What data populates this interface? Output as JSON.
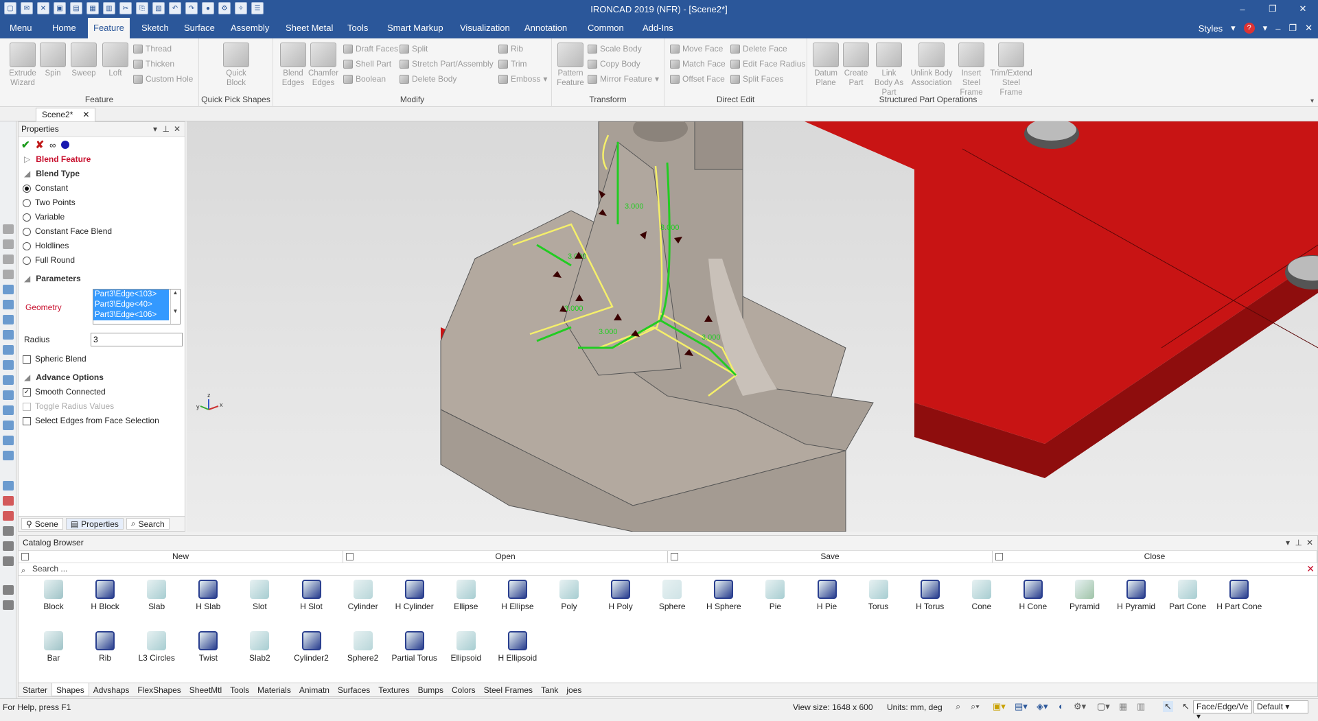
{
  "window": {
    "title": "IRONCAD 2019 (NFR) - [Scene2*]",
    "controls": [
      "–",
      "❐",
      "✕"
    ]
  },
  "menu_tabs": [
    "Menu",
    "Home",
    "Feature",
    "Sketch",
    "Surface",
    "Assembly",
    "Sheet Metal",
    "Tools",
    "Smart Markup",
    "Visualization",
    "Annotation",
    "Common",
    "Add-Ins"
  ],
  "menu_right": {
    "styles": "Styles",
    "help": "?"
  },
  "ribbon": {
    "feature": {
      "label": "Feature",
      "big": [
        "Extrude Wizard",
        "Spin",
        "Sweep",
        "Loft"
      ],
      "small": [
        "Thread",
        "Thicken",
        "Custom Hole"
      ]
    },
    "quick_pick": {
      "label": "Quick Pick Shapes",
      "big": [
        "Quick Block"
      ]
    },
    "modify": {
      "label": "Modify",
      "big": [
        "Blend Edges",
        "Chamfer Edges"
      ],
      "small": [
        "Draft Faces",
        "Shell Part",
        "Boolean",
        "Split",
        "Stretch Part/Assembly",
        "Delete Body",
        "Rib",
        "Trim",
        "Emboss"
      ]
    },
    "transform": {
      "label": "Transform",
      "big": [
        "Pattern Feature"
      ],
      "small": [
        "Scale Body",
        "Copy Body",
        "Mirror Feature"
      ]
    },
    "direct_edit": {
      "label": "Direct Edit",
      "small": [
        "Move Face",
        "Match Face",
        "Offset Face",
        "Delete Face",
        "Edit Face Radius",
        "Split Faces"
      ]
    },
    "structured": {
      "label": "Structured Part Operations",
      "big": [
        "Datum Plane",
        "Create Part",
        "Link Body As Part",
        "Unlink Body Association",
        "Insert Steel Frame",
        "Trim/Extend Steel Frame"
      ]
    }
  },
  "doc_tab": {
    "name": "Scene2*",
    "close": "✕"
  },
  "properties": {
    "title": "Properties",
    "blend_feature": "Blend Feature",
    "blend_type_label": "Blend Type",
    "blend_types": [
      "Constant",
      "Two Points",
      "Variable",
      "Constant Face Blend",
      "Holdlines",
      "Full Round"
    ],
    "selected_type": "Constant",
    "parameters_label": "Parameters",
    "geometry_label": "Geometry",
    "geometry_items": [
      "Part3\\Edge<103>",
      "Part3\\Edge<40>",
      "Part3\\Edge<106>"
    ],
    "radius_label": "Radius",
    "radius_value": "3",
    "spheric_blend": "Spheric Blend",
    "advance_label": "Advance Options",
    "smooth_connected": "Smooth Connected",
    "toggle_radius": "Toggle Radius Values",
    "select_edges": "Select Edges from Face Selection",
    "tabs": [
      "Scene",
      "Properties",
      "Search"
    ]
  },
  "viewport": {
    "dim_labels": [
      "3.000",
      "3.000",
      "3.000",
      "3.000",
      "3.000",
      "3.000"
    ],
    "axes": [
      "z",
      "y",
      "x"
    ]
  },
  "catalog": {
    "title": "Catalog Browser",
    "actions": [
      "New",
      "Open",
      "Save",
      "Close"
    ],
    "search_placeholder": "Search ...",
    "shapes_row1": [
      "Block",
      "H Block",
      "Slab",
      "H Slab",
      "Slot",
      "H Slot",
      "Cylinder",
      "H Cylinder",
      "Ellipse",
      "H Ellipse",
      "Poly",
      "H Poly",
      "Sphere",
      "H Sphere",
      "Pie",
      "H Pie",
      "Torus",
      "H Torus",
      "Cone",
      "H Cone",
      "Pyramid",
      "H Pyramid",
      "Part Cone",
      "H Part Cone"
    ],
    "shapes_row2": [
      "Bar",
      "Rib",
      "L3 Circles",
      "Twist",
      "Slab2",
      "Cylinder2",
      "Sphere2",
      "Partial Torus",
      "Ellipsoid",
      "H Ellipsoid"
    ],
    "tabs": [
      "Starter",
      "Shapes",
      "Advshaps",
      "FlexShapes",
      "SheetMtl",
      "Tools",
      "Materials",
      "Animatn",
      "Surfaces",
      "Textures",
      "Bumps",
      "Colors",
      "Steel Frames",
      "Tank",
      "joes"
    ],
    "active_tab": "Shapes"
  },
  "status": {
    "help": "For Help, press F1",
    "view_size": "View size: 1648 x  600",
    "units": "Units: mm, deg",
    "filter": "Face/Edge/Ve",
    "mode": "Default"
  },
  "colors": {
    "accent": "#2b579a",
    "part_red": "#c81414",
    "part_tan": "#b3a99f",
    "highlight_green": "#22cc22",
    "highlight_yellow": "#f5ef6a"
  }
}
